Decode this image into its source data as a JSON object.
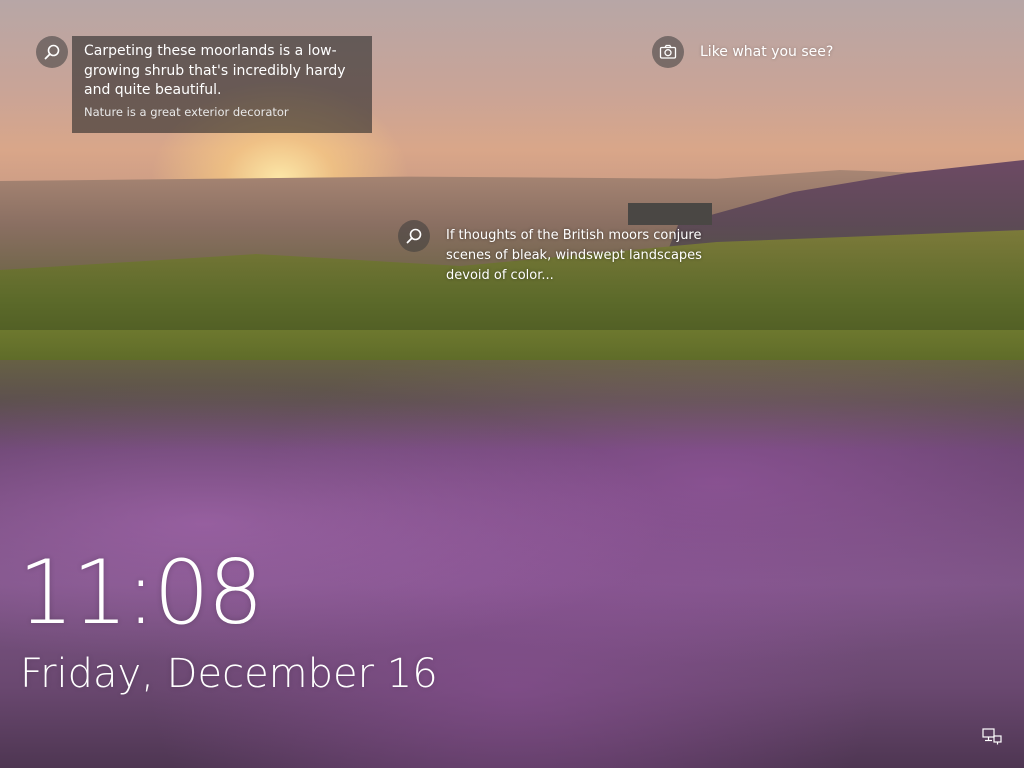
{
  "screen": "Windows lock screen",
  "hotspots": {
    "card": {
      "icon": "search-icon",
      "title": "Carpeting these moorlands is a low-growing shrub that's incredibly hardy and quite beautiful.",
      "subtitle": "Nature is a great exterior decorator"
    },
    "spotlight": {
      "icon": "camera-icon",
      "label": "Like what you see?"
    },
    "landscape": {
      "icon": "search-icon",
      "text": "If thoughts of the British moors conjure scenes of bleak, windswept landscapes devoid of color..."
    }
  },
  "clock": {
    "time": "11:08",
    "date": "Friday, December 16"
  },
  "status_icons": [
    "network-icon"
  ],
  "colors": {
    "text": "#ffffff",
    "card_background": "rgba(40,40,40,0.6)",
    "hotspot_background": "rgba(60,60,60,0.55)"
  }
}
